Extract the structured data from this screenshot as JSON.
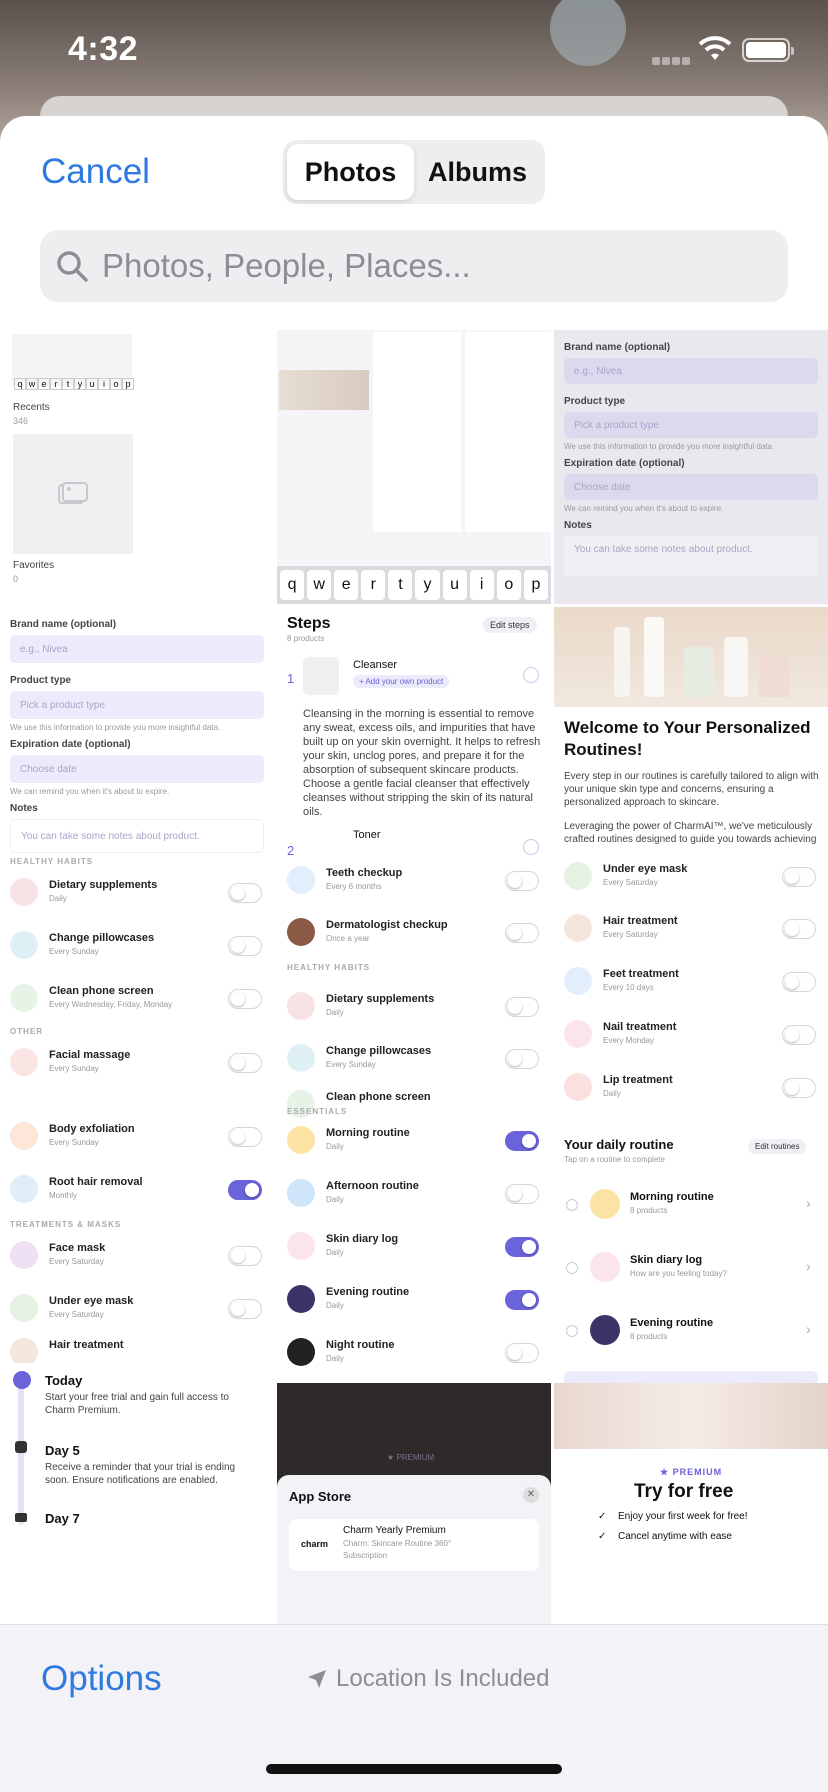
{
  "status_bar": {
    "time": "4:32"
  },
  "header": {
    "cancel_label": "Cancel",
    "tabs": [
      {
        "label": "Photos",
        "active": true
      },
      {
        "label": "Albums",
        "active": false
      }
    ]
  },
  "search": {
    "placeholder": "Photos, People, Places..."
  },
  "thumbnails": {
    "albums": {
      "recents_label": "Recents",
      "recents_count": "346",
      "favorites_label": "Favorites",
      "favorites_count": "0"
    },
    "keyboard_keys": [
      "q",
      "w",
      "e",
      "r",
      "t",
      "y",
      "u",
      "i",
      "o",
      "p"
    ],
    "form": {
      "brand_label": "Brand name (optional)",
      "brand_placeholder": "e.g., Nivea",
      "type_label": "Product type",
      "type_placeholder": "Pick a product type",
      "type_help": "We use this information to provide you more insightful data.",
      "expiration_label": "Expiration date (optional)",
      "expiration_placeholder": "Choose date",
      "expiration_help": "We can remind you when it's about to expire.",
      "notes_label": "Notes",
      "notes_placeholder": "You can take some notes about product."
    },
    "habits_left": {
      "section_healthy": "HEALTHY HABITS",
      "items_healthy": [
        {
          "name": "Dietary supplements",
          "freq": "Daily"
        },
        {
          "name": "Change pillowcases",
          "freq": "Every Sunday"
        },
        {
          "name": "Clean phone screen",
          "freq": "Every Wednesday, Friday, Monday"
        }
      ],
      "section_other": "OTHER",
      "items_other": [
        {
          "name": "Facial massage",
          "freq": "Every Sunday"
        },
        {
          "name": "Body exfoliation",
          "freq": "Every Sunday"
        },
        {
          "name": "Root hair removal",
          "freq": "Monthly"
        }
      ],
      "section_treatments": "TREATMENTS & MASKS",
      "items_treatments": [
        {
          "name": "Face mask",
          "freq": "Every Saturday"
        },
        {
          "name": "Under eye mask",
          "freq": "Every Saturday"
        },
        {
          "name": "Hair treatment",
          "freq": ""
        }
      ]
    },
    "trial": {
      "today_title": "Today",
      "today_text": "Start your free trial and gain full access to Charm Premium.",
      "day5_title": "Day 5",
      "day5_text": "Receive a reminder that your trial is ending soon. Ensure notifications are enabled.",
      "day7_title": "Day 7"
    },
    "steps": {
      "title": "Steps",
      "count": "8 products",
      "edit": "Edit steps",
      "step1_num": "1",
      "step1_name": "Cleanser",
      "step1_add": "+ Add your own product",
      "step1_text": "Cleansing in the morning is essential to remove any sweat, excess oils, and impurities that have built up on your skin overnight. It helps to refresh your skin, unclog pores, and prepare it for the absorption of subsequent skincare products. Choose a gentle facial cleanser that effectively cleanses without stripping the skin of its natural oils.",
      "step2_num": "2",
      "step2_name": "Toner"
    },
    "habits_mid": {
      "items_top": [
        {
          "name": "Teeth checkup",
          "freq": "Every 6 months"
        },
        {
          "name": "Dermatologist checkup",
          "freq": "Once a year"
        }
      ],
      "section_healthy": "HEALTHY HABITS",
      "items_healthy": [
        {
          "name": "Dietary supplements",
          "freq": "Daily"
        },
        {
          "name": "Change pillowcases",
          "freq": "Every Sunday"
        },
        {
          "name": "Clean phone screen",
          "freq": ""
        }
      ],
      "section_essentials": "ESSENTIALS",
      "items_essentials": [
        {
          "name": "Morning routine",
          "freq": "Daily",
          "on": true
        },
        {
          "name": "Afternoon routine",
          "freq": "Daily",
          "on": false
        },
        {
          "name": "Skin diary log",
          "freq": "Daily",
          "on": true
        },
        {
          "name": "Evening routine",
          "freq": "Daily",
          "on": true
        },
        {
          "name": "Night routine",
          "freq": "Daily",
          "on": false
        }
      ]
    },
    "appstore": {
      "premium": "★ PREMIUM",
      "title": "App Store",
      "brand": "charm",
      "product": "Charm Yearly Premium",
      "sub": "Charm: Skincare Routine 360°",
      "type": "Subscription"
    },
    "welcome": {
      "title": "Welcome to Your Personalized Routines!",
      "p1": "Every step in our routines is carefully tailored to align with your unique skin type and concerns, ensuring a personalized approach to skincare.",
      "p2": "Leveraging the power of CharmAI™, we've meticulously crafted routines designed to guide you towards achieving your ideal skin."
    },
    "habits_right": [
      {
        "name": "Under eye mask",
        "freq": "Every Saturday"
      },
      {
        "name": "Hair treatment",
        "freq": "Every Saturday"
      },
      {
        "name": "Feet treatment",
        "freq": "Every 10 days"
      },
      {
        "name": "Nail treatment",
        "freq": "Every Monday"
      },
      {
        "name": "Lip treatment",
        "freq": "Daily"
      }
    ],
    "daily_routine": {
      "title": "Your daily routine",
      "subtitle": "Tap on a routine to complete",
      "edit": "Edit routines",
      "items": [
        {
          "name": "Morning routine",
          "sub": "8 products"
        },
        {
          "name": "Skin diary log",
          "sub": "How are you feeling today?"
        },
        {
          "name": "Evening routine",
          "sub": "8 products"
        }
      ]
    },
    "paywall": {
      "premium": "★ PREMIUM",
      "title": "Try for free",
      "benefits": [
        "Enjoy your first week for free!",
        "Cancel anytime with ease"
      ]
    }
  },
  "bottom": {
    "options_label": "Options",
    "location_label": "Location Is Included"
  }
}
